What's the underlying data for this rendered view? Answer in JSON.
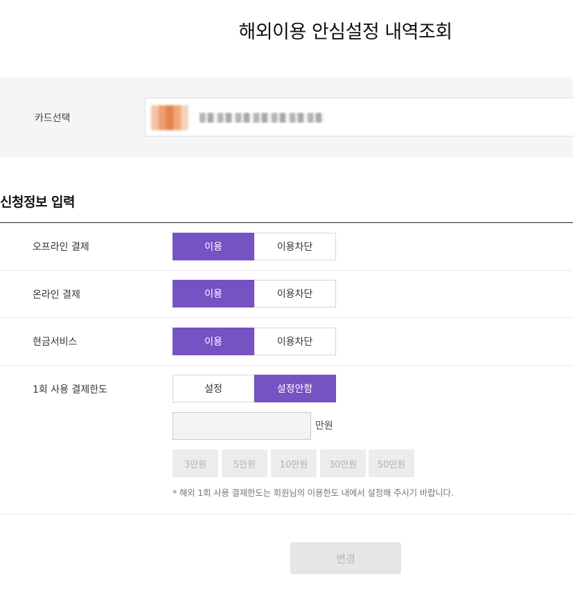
{
  "page": {
    "title": "해외이용 안심설정 내역조회"
  },
  "card": {
    "label": "카드선택",
    "selected_masked": "■ ■■■ ■■■■ ■■ ■■ ■■■"
  },
  "section": {
    "title": "신청정보 입력"
  },
  "rows": [
    {
      "label": "오프라인 결제",
      "options": [
        "이용",
        "이용차단"
      ],
      "selected": "이용"
    },
    {
      "label": "온라인 결제",
      "options": [
        "이용",
        "이용차단"
      ],
      "selected": "이용"
    },
    {
      "label": "현금서비스",
      "options": [
        "이용",
        "이용차단"
      ],
      "selected": "이용"
    },
    {
      "label": "1회 사용 결제한도",
      "options": [
        "설정",
        "설정안함"
      ],
      "selected": "설정안함"
    }
  ],
  "limit": {
    "input_value": "",
    "unit": "만원",
    "quick_amounts": [
      "3만원",
      "5만원",
      "10만원",
      "30만원",
      "50만원"
    ],
    "note": "* 해외 1회 사용 결제한도는 회원님의 이용한도 내에서 설정해 주시기 바랍니다."
  },
  "submit": {
    "label": "변경"
  },
  "colors": {
    "accent": "#7652c3",
    "disabled_bg": "#e6e6e6",
    "disabled_text": "#b5b5b5"
  }
}
